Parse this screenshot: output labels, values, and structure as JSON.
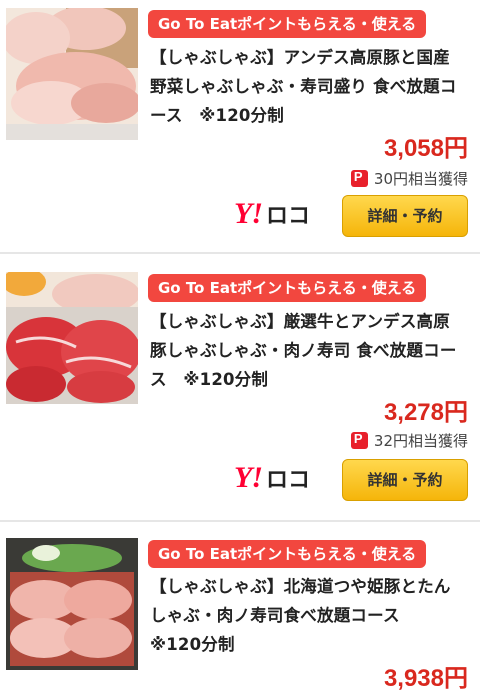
{
  "listings": [
    {
      "badge": "Go To Eatポイントもらえる・使える",
      "title_lines": [
        "【しゃぶしゃぶ】アンデス高原豚と国産",
        "野菜しゃぶしゃぶ・寿司盛り 食べ放題コ",
        "ース　※120分制"
      ],
      "price": "3,058円",
      "points": "30円相当獲得",
      "service_logo": "Y!",
      "service_name": "ロコ",
      "button": "詳細・予約"
    },
    {
      "badge": "Go To Eatポイントもらえる・使える",
      "title_lines": [
        "【しゃぶしゃぶ】厳選牛とアンデス高原",
        "豚しゃぶしゃぶ・肉ノ寿司 食べ放題コー",
        "ス　※120分制"
      ],
      "price": "3,278円",
      "points": "32円相当獲得",
      "service_logo": "Y!",
      "service_name": "ロコ",
      "button": "詳細・予約"
    },
    {
      "badge": "Go To Eatポイントもらえる・使える",
      "title_lines": [
        "【しゃぶしゃぶ】北海道つや姫豚とたん",
        "しゃぶ・肉ノ寿司食べ放題コース",
        "※120分制"
      ],
      "price": "3,938円"
    }
  ],
  "colors": {
    "badge": "#f2473f",
    "price": "#d9281e",
    "button": "#f5b50a",
    "yahoo": "#ff0033"
  }
}
